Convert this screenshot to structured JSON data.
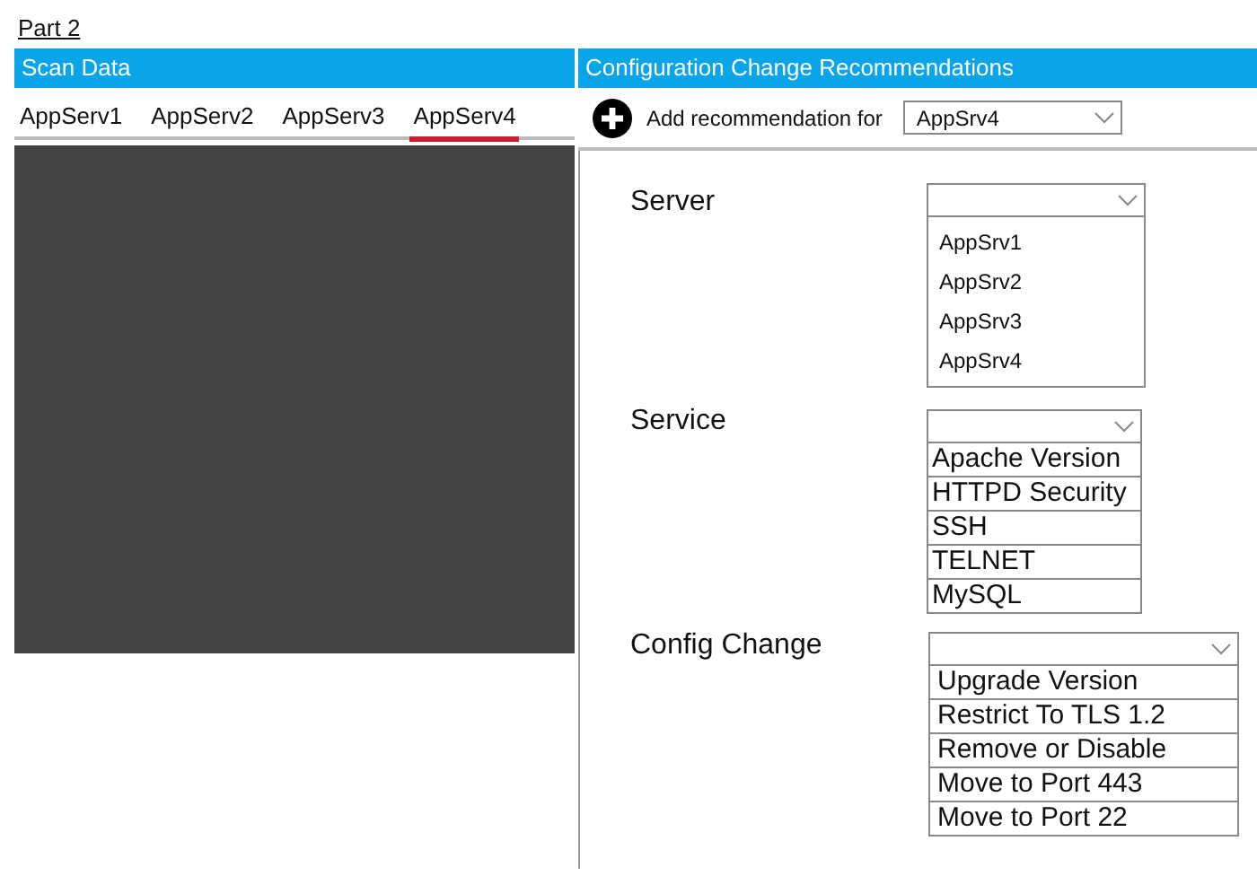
{
  "heading": "Part 2",
  "scan_data": {
    "title": "Scan Data",
    "tabs": [
      {
        "label": "AppServ1",
        "selected": false
      },
      {
        "label": "AppServ2",
        "selected": false
      },
      {
        "label": "AppServ3",
        "selected": false
      },
      {
        "label": "AppServ4",
        "selected": true
      }
    ]
  },
  "recommendations": {
    "title": "Configuration Change Recommendations",
    "add_label": "Add recommendation for",
    "add_value": "AppSrv4",
    "fields": [
      {
        "label": "Server",
        "kind": "list",
        "options": [
          "AppSrv1",
          "AppSrv2",
          "AppSrv3",
          "AppSrv4"
        ]
      },
      {
        "label": "Service",
        "kind": "boxed",
        "options": [
          "Apache Version",
          "HTTPD Security",
          "SSH",
          "TELNET",
          "MySQL"
        ]
      },
      {
        "label": "Config Change",
        "kind": "wide",
        "options": [
          "Upgrade Version",
          "Restrict To TLS 1.2",
          "Remove or Disable",
          "Move to Port 443",
          "Move to Port 22"
        ]
      }
    ]
  }
}
